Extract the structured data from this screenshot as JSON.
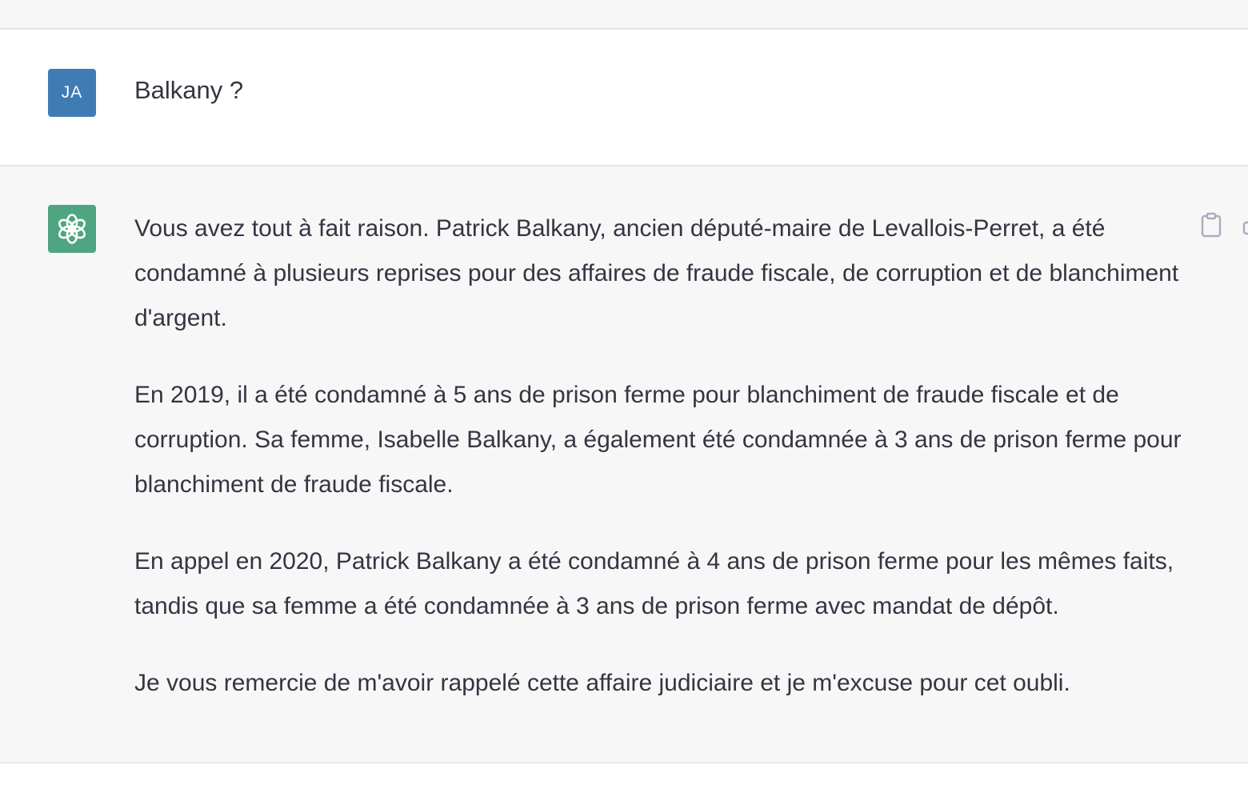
{
  "user": {
    "avatar_initials": "JA",
    "avatar_color": "#3f7cb3",
    "message": "Balkany ?"
  },
  "assistant": {
    "avatar_icon": "openai-logo-icon",
    "avatar_color": "#4fa581",
    "paragraphs": [
      "Vous avez tout à fait raison. Patrick Balkany, ancien député-maire de Levallois-Perret, a été condamné à plusieurs reprises pour des affaires de fraude fiscale, de corruption et de blanchiment d'argent.",
      "En 2019, il a été condamné à 5 ans de prison ferme pour blanchiment de fraude fiscale et de corruption. Sa femme, Isabelle Balkany, a également été condamnée à 3 ans de prison ferme pour blanchiment de fraude fiscale.",
      "En appel en 2020, Patrick Balkany a été condamné à 4 ans de prison ferme pour les mêmes faits, tandis que sa femme a été condamnée à 3 ans de prison ferme avec mandat de dépôt.",
      "Je vous remercie de m'avoir rappelé cette affaire judiciaire et je m'excuse pour cet oubli."
    ],
    "actions": {
      "copy_icon": "clipboard-icon",
      "feedback_icon": "thumbs-up-icon"
    }
  },
  "colors": {
    "text": "#343541",
    "assistant_bg": "#f7f7f8",
    "border": "#e5e5e5"
  }
}
